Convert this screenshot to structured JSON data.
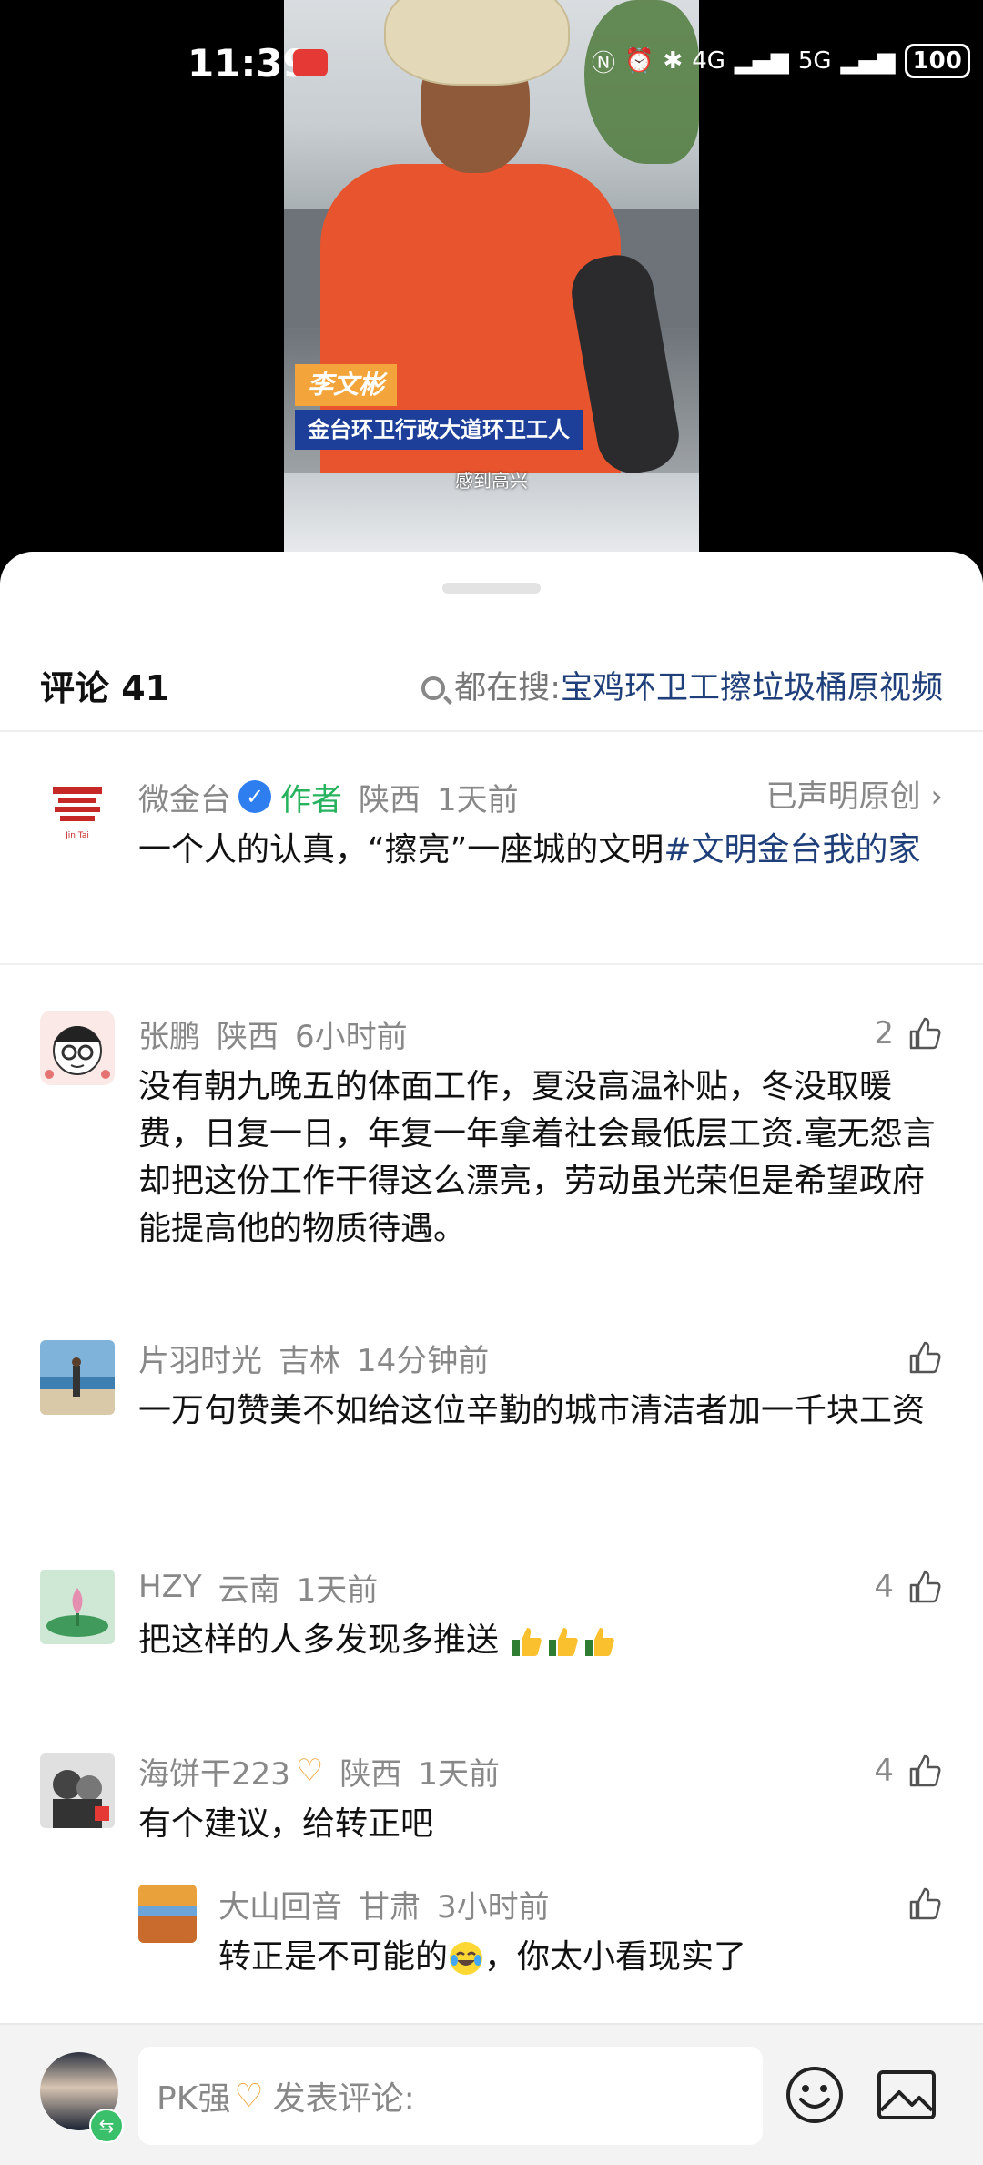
{
  "status_bar": {
    "time": "11:39",
    "network_4g": "4G",
    "network_5g": "5G",
    "battery": "100"
  },
  "video": {
    "caption_name": "李文彬",
    "caption_role": "金台环卫行政大道环卫工人",
    "subtitle": "感到高兴"
  },
  "header": {
    "title": "评论 41",
    "search_label": "都在搜:",
    "search_query": "宝鸡环卫工擦垃圾桶原视频"
  },
  "comments": [
    {
      "author": "微金台",
      "author_tag": "作者",
      "location": "陕西",
      "time": "1天前",
      "declared": "已声明原创",
      "text": "一个人的认真，“擦亮”一座城的文明",
      "hashtag": "#文明金台我的家",
      "avatar_mark": "Jin Tai"
    },
    {
      "author": "张鹏",
      "location": "陕西",
      "time": "6小时前",
      "likes": "2",
      "text": "没有朝九晚五的体面工作，夏没高温补贴，冬没取暖费，日复一日，年复一年拿着社会最低层工资.毫无怨言却把这份工作干得这么漂亮，劳动虽光荣但是希望政府能提高他的物质待遇。"
    },
    {
      "author": "片羽时光",
      "location": "吉林",
      "time": "14分钟前",
      "likes": "",
      "text": "一万句赞美不如给这位辛勤的城市清洁者加一千块工资"
    },
    {
      "author": "HZY",
      "location": "云南",
      "time": "1天前",
      "likes": "4",
      "text": "把这样的人多发现多推送"
    },
    {
      "author": "海饼干223",
      "location": "陕西",
      "time": "1天前",
      "likes": "4",
      "text": "有个建议，给转正吧",
      "reply": {
        "author": "大山回音",
        "location": "甘肃",
        "time": "3小时前",
        "likes": "",
        "text_before": "转正是不可能的",
        "text_after": "，你太小看现实了"
      }
    }
  ],
  "bottom_bar": {
    "user_name": "PK强",
    "placeholder": "发表评论:"
  },
  "icons": {
    "like": "thumbs-up-icon",
    "verified": "verified-badge-icon",
    "emoji": "emoji-icon",
    "image": "image-icon",
    "search": "search-icon"
  },
  "colors": {
    "hashtag": "#1f3f7a",
    "author_tag": "#27b35d",
    "verified": "#2f7ef0",
    "meta": "#888888"
  }
}
